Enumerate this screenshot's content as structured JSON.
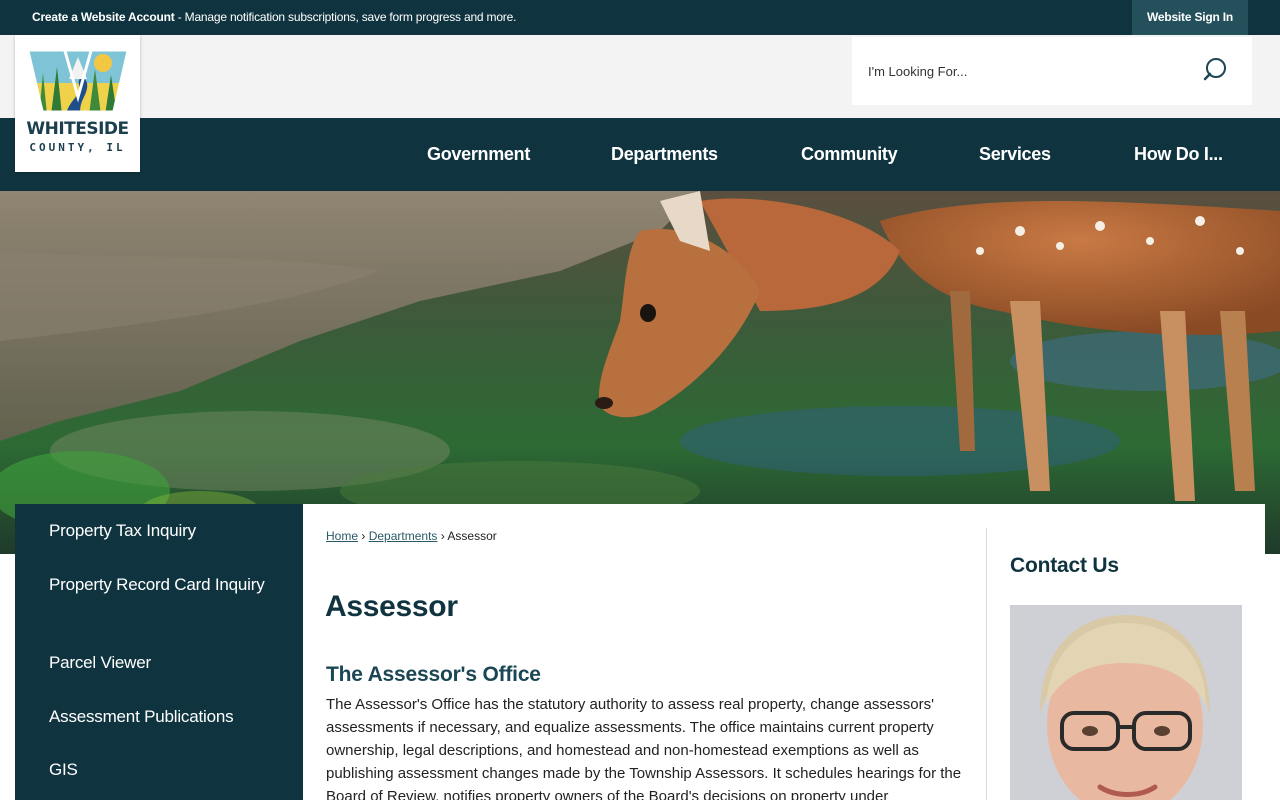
{
  "topbar": {
    "create_account": "Create a Website Account",
    "message": " - Manage notification subscriptions, save form progress and more.",
    "sign_in": "Website Sign In"
  },
  "logo": {
    "line1": "WHITESIDE",
    "line2": "COUNTY, IL"
  },
  "search": {
    "placeholder": "I'm Looking For...",
    "icon": "search-icon"
  },
  "nav": {
    "items": [
      "Government",
      "Departments",
      "Community",
      "Services",
      "How Do I..."
    ]
  },
  "sidebar": {
    "items": [
      "Property Tax Inquiry",
      "Property Record Card Inquiry",
      "Parcel Viewer",
      "Assessment Publications",
      "GIS"
    ]
  },
  "breadcrumb": {
    "home": "Home",
    "sep": "›",
    "departments": "Departments",
    "current": "Assessor"
  },
  "main": {
    "title": "Assessor",
    "section_title": "The Assessor's Office",
    "body": "The Assessor's Office has the statutory authority to assess real property, change assessors' assessments if necessary, and equalize assessments. The office maintains current property ownership, legal descriptions, and homestead and non-homestead exemptions as well as publishing assessment changes made by the Township Assessors. It schedules hearings for the Board of Review, notifies property owners of the Board's decisions on property under"
  },
  "contact": {
    "title": "Contact Us"
  },
  "colors": {
    "primary_dark": "#10343f",
    "signin_bg": "#23505b",
    "heading": "#10343f"
  }
}
